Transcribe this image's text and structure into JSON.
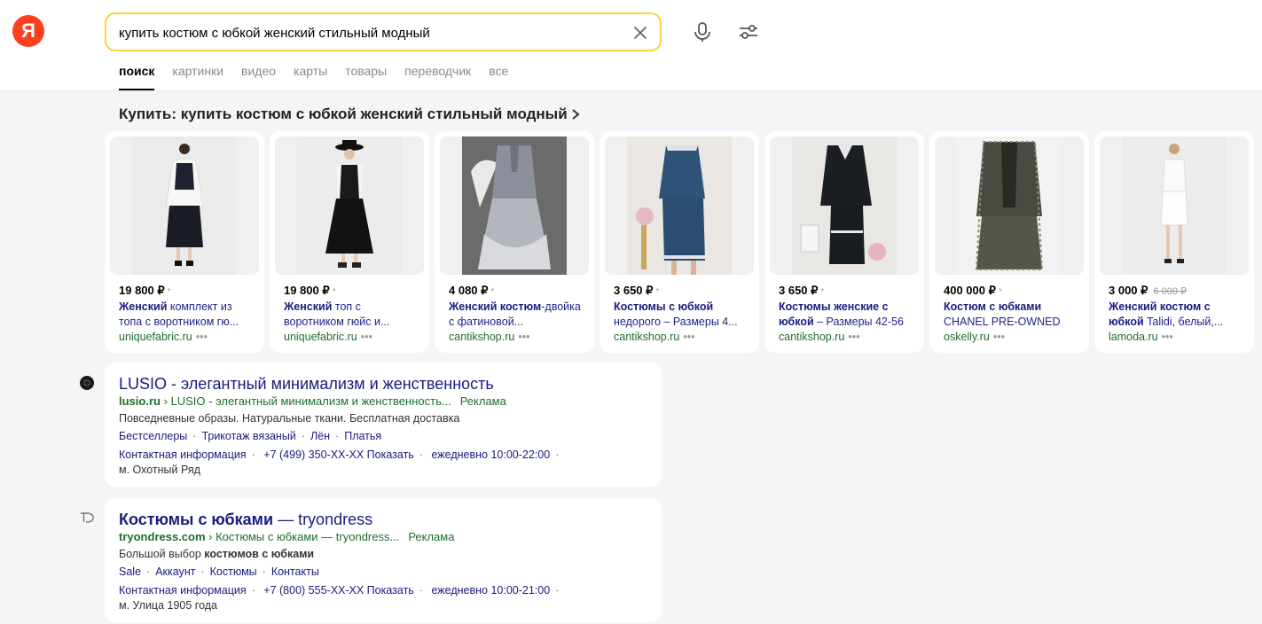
{
  "logo": {
    "letter": "Я",
    "color": "#fc3f1d"
  },
  "search": {
    "value": "купить костюм с юбкой женский стильный модный",
    "border_color": "#fdd13a"
  },
  "tabs": [
    {
      "label": "поиск",
      "active": true
    },
    {
      "label": "картинки"
    },
    {
      "label": "видео"
    },
    {
      "label": "карты"
    },
    {
      "label": "товары"
    },
    {
      "label": "переводчик"
    },
    {
      "label": "все"
    }
  ],
  "shopping": {
    "title": "Купить: купить костюм с юбкой женский стильный модный",
    "products": [
      {
        "price": "19 800 ₽",
        "star": "*",
        "title_bold": "Женский",
        "title_rest": " комплект из топа с воротником гю...",
        "shop": "uniquefabric.ru",
        "dots": "•••"
      },
      {
        "price": "19 800 ₽",
        "star": "*",
        "title_bold": "Женский",
        "title_rest": " топ с воротником гюйс и...",
        "shop": "uniquefabric.ru",
        "dots": "•••"
      },
      {
        "price": "4 080 ₽",
        "star": "*",
        "title_bold": "Женский костюм",
        "title_rest": "-двойка с фатиновой...",
        "shop": "cantikshop.ru",
        "dots": "•••"
      },
      {
        "price": "3 650 ₽",
        "star": "*",
        "title_bold": "Костюмы с юбкой",
        "title_rest": " недорого – Размеры 4...",
        "shop": "cantikshop.ru",
        "dots": "•••"
      },
      {
        "price": "3 650 ₽",
        "star": "*",
        "title_bold": "Костюмы женские с юбкой",
        "title_rest": " – Размеры 42-56",
        "shop": "cantikshop.ru",
        "dots": "•••"
      },
      {
        "price": "400 000 ₽",
        "star": "*",
        "title_bold": "Костюм с юбками",
        "title_rest": " CHANEL PRE-OWNED",
        "shop": "oskelly.ru",
        "dots": "•••"
      },
      {
        "price": "3 000 ₽",
        "star": "*",
        "old_price": "6 000 ₽",
        "title_bold": "Женский костюм с юбкой",
        "title_rest": " Talidi, белый,...",
        "shop": "lamoda.ru",
        "dots": "•••"
      }
    ]
  },
  "ads": [
    {
      "title_bold": "",
      "title_rest": "LUSIO - элегантный минимализм и женственность",
      "domain": "lusio.ru",
      "path": " › LUSIO - элегантный минимализм и женственность...",
      "ad_label": "Реклама",
      "desc_plain": "Повседневные образы. Натуральные ткани. Бесплатная доставка",
      "desc_bold": "",
      "links": [
        "Бестселлеры",
        "Трикотаж вязаный",
        "Лён",
        "Платья"
      ],
      "contact": "Контактная информация",
      "phone": "+7 (499) 350-XX-XX Показать",
      "hours": "ежедневно 10:00-22:00",
      "dot": "·",
      "metro": "м. Охотный Ряд"
    },
    {
      "title_bold": "Костюмы с юбками",
      "title_rest": " — tryondress",
      "domain": "tryondress.com",
      "path": " › Костюмы с юбками — tryondress...",
      "ad_label": "Реклама",
      "desc_plain": "Большой выбор ",
      "desc_bold": "костюмов с юбками",
      "links": [
        "Sale",
        "Аккаунт",
        "Костюмы",
        "Контакты"
      ],
      "contact": "Контактная информация",
      "phone": "+7 (800) 555-XX-XX Показать",
      "hours": "ежедневно 10:00-21:00",
      "dot": "·",
      "metro": "м. Улица 1905 года"
    }
  ],
  "link_separator": "·"
}
